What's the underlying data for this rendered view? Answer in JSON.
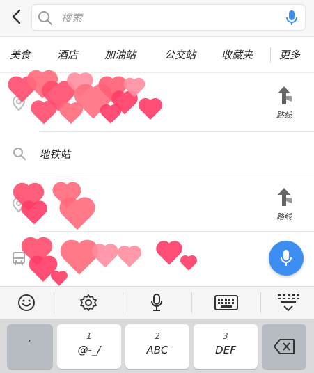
{
  "search": {
    "placeholder": "搜索"
  },
  "categories": [
    "美食",
    "酒店",
    "加油站",
    "公交站",
    "收藏夹",
    "更多"
  ],
  "list": {
    "row1": {
      "title": "",
      "route_label": "路线"
    },
    "row2": {
      "title": "地铁站"
    },
    "row3": {
      "title": "",
      "route_label": "路线"
    },
    "row4": {
      "title": ""
    }
  },
  "keyboard": {
    "keys": [
      {
        "num": "",
        "main": ","
      },
      {
        "num": "1",
        "main": "@-_/"
      },
      {
        "num": "2",
        "main": "ABC"
      },
      {
        "num": "3",
        "main": "DEF"
      }
    ]
  },
  "colors": {
    "accent": "#3d8ef3",
    "heart": "#ff4d6d"
  }
}
